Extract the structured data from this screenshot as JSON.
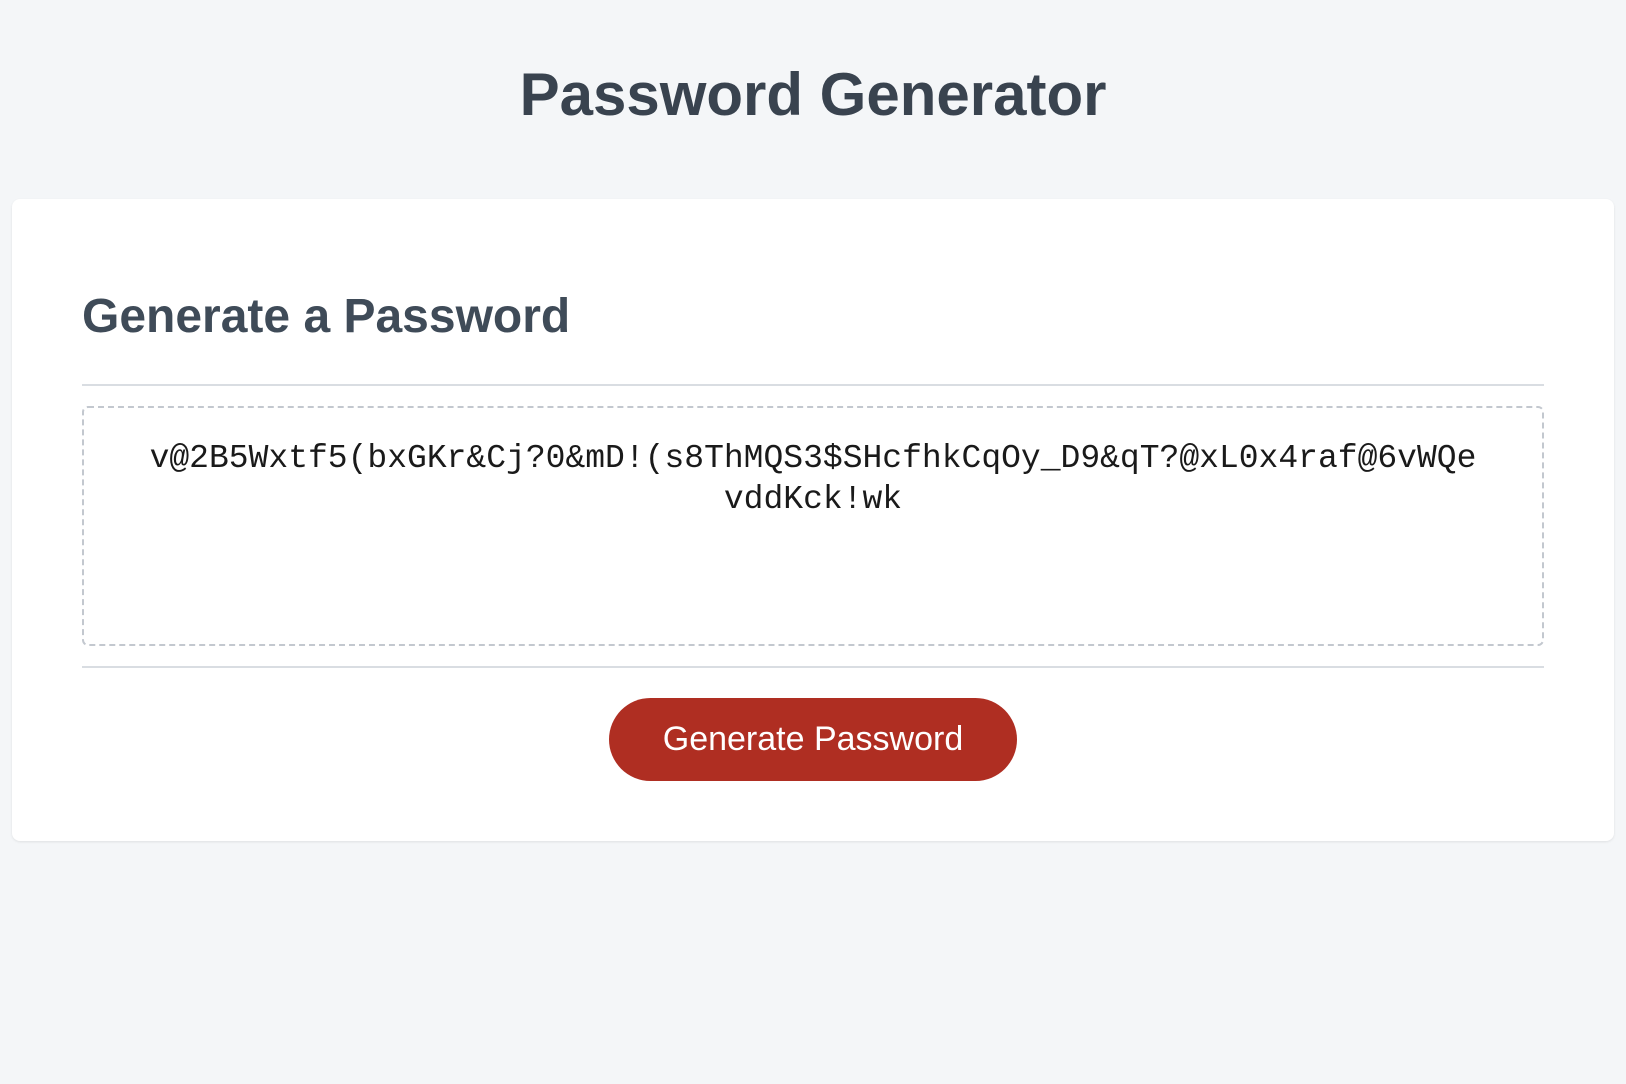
{
  "header": {
    "title": "Password Generator"
  },
  "card": {
    "heading": "Generate a Password",
    "password_value": "v@2B5Wxtf5(bxGKr&Cj?0&mD!(s8ThMQS3$SHcfhkCqOy_D9&qT?@xL0x4raf@6vWQevddKck!wk",
    "generate_button_label": "Generate Password"
  },
  "colors": {
    "accent": "#af2e22",
    "page_bg": "#f4f6f8",
    "card_bg": "#ffffff",
    "heading_text": "#39434f",
    "border": "#d9dde2",
    "dashed_border": "#c3c8cf"
  }
}
